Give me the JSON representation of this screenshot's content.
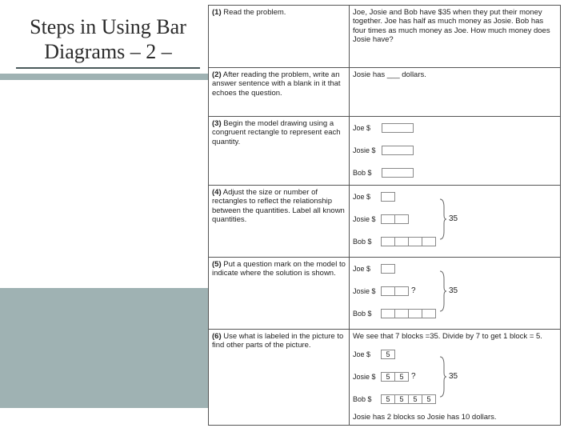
{
  "title": "Steps in Using Bar Diagrams – 2 –",
  "steps": [
    {
      "num": "(1)",
      "label": "Read the problem.",
      "right": "Joe, Josie and Bob have $35 when they put their money together. Joe has half as much money as Josie. Bob has four times as much money as Joe. How much money does Josie have?"
    },
    {
      "num": "(2)",
      "label": "After reading the problem, write an answer sentence with a blank in it that echoes the question.",
      "right": "Josie has ___ dollars."
    },
    {
      "num": "(3)",
      "label": "Begin the model drawing using a congruent rectangle to represent each quantity."
    },
    {
      "num": "(4)",
      "label": "Adjust the size or number of rectangles to reflect the relationship between the quantities. Label all known quantities."
    },
    {
      "num": "(5)",
      "label": "Put a question mark on the model to indicate where the solution is shown."
    },
    {
      "num": "(6)",
      "label": "Use what is labeled in the picture to find other parts of the picture.",
      "rightTop": "We see that 7 blocks =35. Divide by 7 to get 1 block = 5.",
      "rightBottom": "Josie has 2 blocks so Josie has 10 dollars."
    }
  ],
  "names": {
    "joe": "Joe $",
    "josie": "Josie $",
    "bob": "Bob $"
  },
  "brace_total": "35",
  "qmark": "?",
  "vals": {
    "five": "5"
  }
}
